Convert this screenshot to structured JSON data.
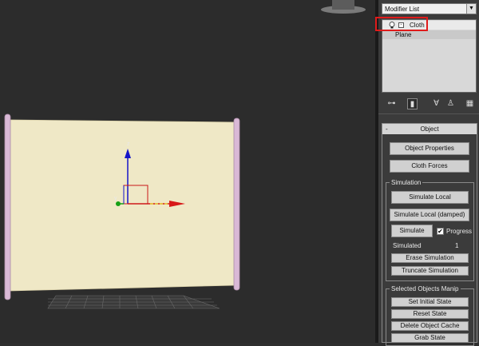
{
  "modifier_list": {
    "label": "Modifier List",
    "arrow": "▼"
  },
  "stack": {
    "items": [
      {
        "label": "Cloth",
        "expander": "-"
      },
      {
        "label": "Plane"
      }
    ]
  },
  "toolbar": {
    "icons": [
      "pin-stack-icon",
      "show-end-result-icon",
      "make-unique-icon",
      "remove-modifier-icon",
      "configure-sets-icon"
    ]
  },
  "rollout": {
    "title": "Object",
    "collapse": "-",
    "object_properties": "Object Properties",
    "cloth_forces": "Cloth Forces",
    "simulation": {
      "title": "Simulation",
      "simulate_local": "Simulate Local",
      "simulate_local_damped": "Simulate Local (damped)",
      "simulate": "Simulate",
      "progress": "Progress",
      "progress_checked": true,
      "simulated_label": "Simulated",
      "simulated_value": "1",
      "erase_simulation": "Erase Simulation",
      "truncate_simulation": "Truncate Simulation"
    },
    "selected_objects": {
      "title": "Selected Objects Manip",
      "set_initial_state": "Set Initial State",
      "reset_state": "Reset State",
      "delete_object_cache": "Delete Object Cache",
      "grab_state": "Grab State"
    }
  },
  "viewport": {
    "axis_z": "z",
    "axis_y": "y"
  },
  "colors": {
    "highlight": "#e01b1b",
    "cloth": "#efe8c6",
    "pole": "#d9b8d6"
  }
}
